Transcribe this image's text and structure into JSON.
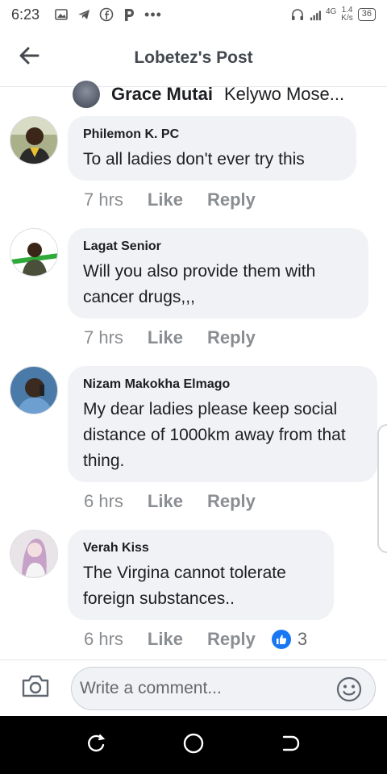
{
  "status_bar": {
    "time": "6:23",
    "more": "•••",
    "network_type": "4G",
    "speed_value": "1.4",
    "speed_unit": "K/s",
    "battery": "36",
    "icons": [
      "image-icon",
      "telegram-icon",
      "facebook-icon",
      "p-app-icon",
      "headphones-icon",
      "signal-icon"
    ]
  },
  "header": {
    "title": "Lobetez's Post",
    "back_icon": "arrow-left-icon"
  },
  "partial_comment": {
    "author": "Grace Mutai",
    "preview": "Kelywo Mose..."
  },
  "comments": [
    {
      "author": "Philemon K. PC",
      "text": "To all ladies don't ever try this",
      "time": "7 hrs",
      "like": "Like",
      "reply": "Reply"
    },
    {
      "author": "Lagat Senior",
      "text": "Will you also provide them with cancer drugs,,,",
      "time": "7 hrs",
      "like": "Like",
      "reply": "Reply"
    },
    {
      "author": "Nizam Makokha Elmago",
      "text": "My dear ladies please keep social distance of 1000km away from that thing.",
      "time": "6 hrs",
      "like": "Like",
      "reply": "Reply"
    },
    {
      "author": "Verah Kiss",
      "text": "The Virgina cannot tolerate foreign substances..",
      "time": "6 hrs",
      "like": "Like",
      "reply": "Reply",
      "reaction_count": "3"
    }
  ],
  "composer": {
    "placeholder": "Write a comment...",
    "camera_icon": "camera-icon",
    "emoji_icon": "emoji-icon"
  },
  "navbar": {
    "icons": [
      "recent-apps-icon",
      "home-icon",
      "back-icon"
    ]
  },
  "colors": {
    "bubble": "#f0f2f5",
    "meta_text": "#8a8d91",
    "accent": "#1877f2"
  }
}
